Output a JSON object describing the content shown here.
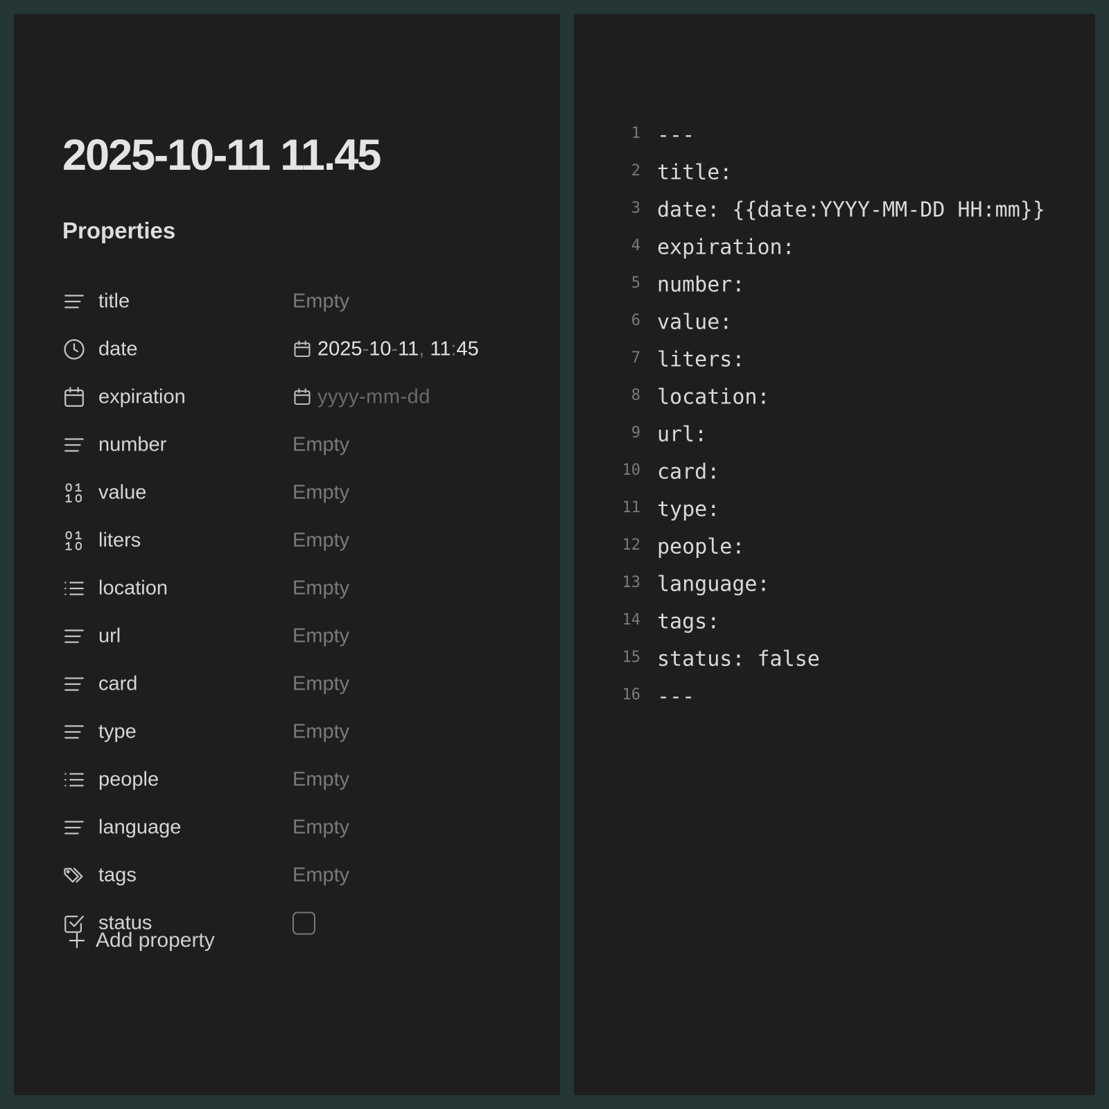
{
  "note": {
    "title": "2025-10-11 11.45"
  },
  "properties": {
    "heading": "Properties",
    "items": [
      {
        "key": "title",
        "icon": "text-lines-icon",
        "value": "Empty"
      },
      {
        "key": "date",
        "icon": "clock-icon",
        "value_parts": [
          "2025",
          "-",
          "10",
          "-",
          "11",
          ",",
          " 11",
          ":",
          "45"
        ]
      },
      {
        "key": "expiration",
        "icon": "calendar-icon",
        "placeholder": "yyyy-mm-dd"
      },
      {
        "key": "number",
        "icon": "text-lines-icon",
        "value": "Empty"
      },
      {
        "key": "value",
        "icon": "binary-number-icon",
        "value": "Empty"
      },
      {
        "key": "liters",
        "icon": "binary-number-icon",
        "value": "Empty"
      },
      {
        "key": "location",
        "icon": "list-icon",
        "value": "Empty"
      },
      {
        "key": "url",
        "icon": "text-lines-icon",
        "value": "Empty"
      },
      {
        "key": "card",
        "icon": "text-lines-icon",
        "value": "Empty"
      },
      {
        "key": "type",
        "icon": "text-lines-icon",
        "value": "Empty"
      },
      {
        "key": "people",
        "icon": "list-icon",
        "value": "Empty"
      },
      {
        "key": "language",
        "icon": "text-lines-icon",
        "value": "Empty"
      },
      {
        "key": "tags",
        "icon": "tags-icon",
        "value": "Empty"
      },
      {
        "key": "status",
        "icon": "checkbox-icon",
        "checked": false
      }
    ],
    "add_label": "Add property"
  },
  "source": {
    "lines": [
      {
        "num": "1",
        "text": "---"
      },
      {
        "num": "2",
        "text": "title:"
      },
      {
        "num": "3",
        "text": "date: {{date:YYYY-MM-DD HH:mm}}"
      },
      {
        "num": "4",
        "text": "expiration:"
      },
      {
        "num": "5",
        "text": "number:"
      },
      {
        "num": "6",
        "text": "value:"
      },
      {
        "num": "7",
        "text": "liters:"
      },
      {
        "num": "8",
        "text": "location:"
      },
      {
        "num": "9",
        "text": "url:"
      },
      {
        "num": "10",
        "text": "card:"
      },
      {
        "num": "11",
        "text": "type:"
      },
      {
        "num": "12",
        "text": "people:"
      },
      {
        "num": "13",
        "text": "language:"
      },
      {
        "num": "14",
        "text": "tags:"
      },
      {
        "num": "15",
        "text": "status: false"
      },
      {
        "num": "16",
        "text": "---"
      }
    ]
  },
  "colors": {
    "background": "#243635",
    "pane": "#1e1e1e",
    "text": "#dadada",
    "muted": "#7a7a7a"
  }
}
